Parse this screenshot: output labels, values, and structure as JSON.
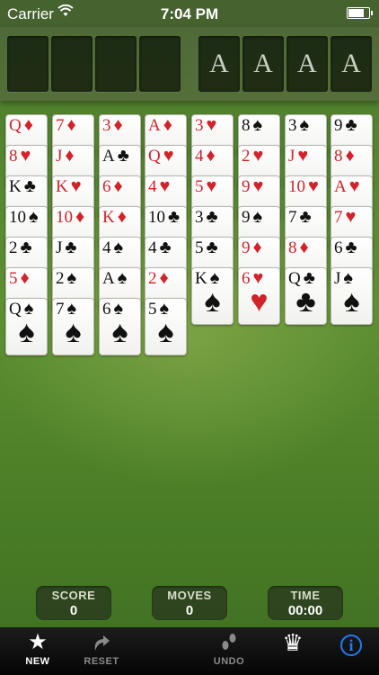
{
  "status_bar": {
    "carrier": "Carrier",
    "time": "7:04 PM",
    "battery_level": 0.85
  },
  "foundations": [
    "A",
    "A",
    "A",
    "A"
  ],
  "tableau": [
    [
      {
        "rank": "Q",
        "suit": "♦",
        "color": "red"
      },
      {
        "rank": "8",
        "suit": "♥",
        "color": "red"
      },
      {
        "rank": "K",
        "suit": "♣",
        "color": "black"
      },
      {
        "rank": "10",
        "suit": "♠",
        "color": "black"
      },
      {
        "rank": "2",
        "suit": "♣",
        "color": "black"
      },
      {
        "rank": "5",
        "suit": "♦",
        "color": "red"
      },
      {
        "rank": "Q",
        "suit": "♠",
        "color": "black"
      }
    ],
    [
      {
        "rank": "7",
        "suit": "♦",
        "color": "red"
      },
      {
        "rank": "J",
        "suit": "♦",
        "color": "red"
      },
      {
        "rank": "K",
        "suit": "♥",
        "color": "red"
      },
      {
        "rank": "10",
        "suit": "♦",
        "color": "red"
      },
      {
        "rank": "J",
        "suit": "♣",
        "color": "black"
      },
      {
        "rank": "2",
        "suit": "♠",
        "color": "black"
      },
      {
        "rank": "7",
        "suit": "♠",
        "color": "black"
      }
    ],
    [
      {
        "rank": "3",
        "suit": "♦",
        "color": "red"
      },
      {
        "rank": "A",
        "suit": "♣",
        "color": "black"
      },
      {
        "rank": "6",
        "suit": "♦",
        "color": "red"
      },
      {
        "rank": "K",
        "suit": "♦",
        "color": "red"
      },
      {
        "rank": "4",
        "suit": "♠",
        "color": "black"
      },
      {
        "rank": "A",
        "suit": "♠",
        "color": "black"
      },
      {
        "rank": "6",
        "suit": "♠",
        "color": "black"
      }
    ],
    [
      {
        "rank": "A",
        "suit": "♦",
        "color": "red"
      },
      {
        "rank": "Q",
        "suit": "♥",
        "color": "red"
      },
      {
        "rank": "4",
        "suit": "♥",
        "color": "red"
      },
      {
        "rank": "10",
        "suit": "♣",
        "color": "black"
      },
      {
        "rank": "4",
        "suit": "♣",
        "color": "black"
      },
      {
        "rank": "2",
        "suit": "♦",
        "color": "red"
      },
      {
        "rank": "5",
        "suit": "♠",
        "color": "black"
      }
    ],
    [
      {
        "rank": "3",
        "suit": "♥",
        "color": "red"
      },
      {
        "rank": "4",
        "suit": "♦",
        "color": "red"
      },
      {
        "rank": "5",
        "suit": "♥",
        "color": "red"
      },
      {
        "rank": "3",
        "suit": "♣",
        "color": "black"
      },
      {
        "rank": "5",
        "suit": "♣",
        "color": "black"
      },
      {
        "rank": "K",
        "suit": "♠",
        "color": "black"
      }
    ],
    [
      {
        "rank": "8",
        "suit": "♠",
        "color": "black"
      },
      {
        "rank": "2",
        "suit": "♥",
        "color": "red"
      },
      {
        "rank": "9",
        "suit": "♥",
        "color": "red"
      },
      {
        "rank": "9",
        "suit": "♠",
        "color": "black"
      },
      {
        "rank": "9",
        "suit": "♦",
        "color": "red"
      },
      {
        "rank": "6",
        "suit": "♥",
        "color": "red"
      }
    ],
    [
      {
        "rank": "3",
        "suit": "♠",
        "color": "black"
      },
      {
        "rank": "J",
        "suit": "♥",
        "color": "red"
      },
      {
        "rank": "10",
        "suit": "♥",
        "color": "red"
      },
      {
        "rank": "7",
        "suit": "♣",
        "color": "black"
      },
      {
        "rank": "8",
        "suit": "♦",
        "color": "red"
      },
      {
        "rank": "Q",
        "suit": "♣",
        "color": "black"
      }
    ],
    [
      {
        "rank": "9",
        "suit": "♣",
        "color": "black"
      },
      {
        "rank": "8",
        "suit": "♦",
        "color": "red"
      },
      {
        "rank": "A",
        "suit": "♥",
        "color": "red"
      },
      {
        "rank": "7",
        "suit": "♥",
        "color": "red"
      },
      {
        "rank": "6",
        "suit": "♣",
        "color": "black"
      },
      {
        "rank": "J",
        "suit": "♠",
        "color": "black"
      }
    ]
  ],
  "stats": {
    "score_label": "SCORE",
    "score_value": "0",
    "moves_label": "MOVES",
    "moves_value": "0",
    "time_label": "TIME",
    "time_value": "00:00"
  },
  "toolbar": {
    "new_label": "NEW",
    "reset_label": "RESET",
    "undo_label": "UNDO"
  },
  "icons": {
    "new": "star-icon",
    "reset": "redo-arrow-icon",
    "undo": "footprints-icon",
    "leaderboard": "crown-icon",
    "info": "info-icon"
  },
  "colors": {
    "felt": "#5f8f33",
    "red_suit": "#d0232a",
    "black_suit": "#111111",
    "info_blue": "#1e7cf2"
  }
}
